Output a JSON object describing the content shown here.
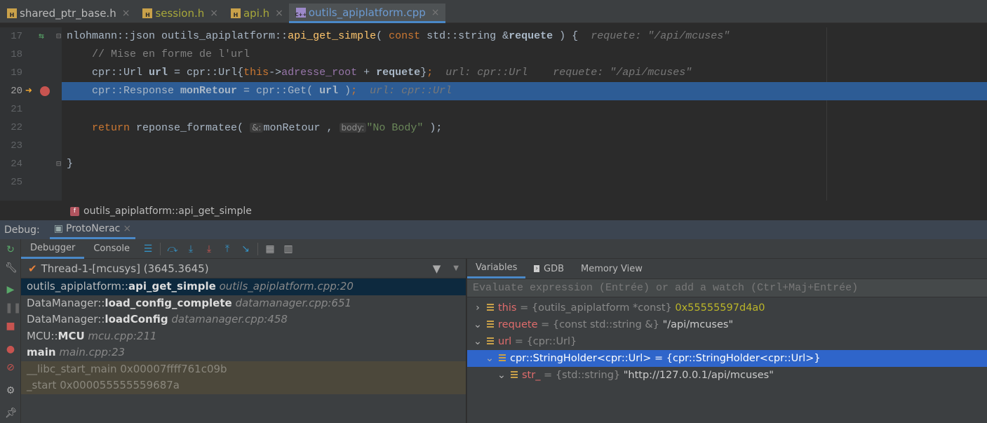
{
  "tabs": [
    {
      "label": "shared_ptr_base.h",
      "type": "H",
      "color": "#bbbbbb"
    },
    {
      "label": "session.h",
      "type": "H",
      "color": "#a8a83a"
    },
    {
      "label": "api.h",
      "type": "H",
      "color": "#a8a83a"
    },
    {
      "label": "outils_apiplatform.cpp",
      "type": "C++",
      "color": "#6c9bd2",
      "active": true
    }
  ],
  "code": [
    {
      "n": "17",
      "tokens": [
        [
          "nlohmann::json outils_apiplatform::",
          "def"
        ],
        [
          "api_get_simple",
          "fn"
        ],
        [
          "( ",
          "def"
        ],
        [
          "const ",
          "kw"
        ],
        [
          "std::string &",
          "def"
        ],
        [
          "requete",
          "bold"
        ],
        [
          " ) {  ",
          "def"
        ],
        [
          "requete: \"/api/mcuses\"",
          "hint"
        ]
      ]
    },
    {
      "n": "18",
      "tokens": [
        [
          "    // Mise en forme de l'url",
          "cm"
        ]
      ]
    },
    {
      "n": "19",
      "tokens": [
        [
          "    cpr::Url ",
          "def"
        ],
        [
          "url",
          "bold"
        ],
        [
          " = cpr::",
          "def"
        ],
        [
          "Url",
          "fn2"
        ],
        [
          "{",
          "def"
        ],
        [
          "this",
          "kw"
        ],
        [
          "->",
          "def"
        ],
        [
          "adresse_root",
          "field"
        ],
        [
          " + ",
          "def"
        ],
        [
          "requete",
          "bold"
        ],
        [
          "}",
          "def"
        ],
        [
          ";",
          "kw"
        ],
        [
          "  url: cpr::Url    requete: \"/api/mcuses\"",
          "hint"
        ]
      ]
    },
    {
      "n": "20",
      "current": true,
      "tokens": [
        [
          "    cpr::Response ",
          "def"
        ],
        [
          "monRetour",
          "bold"
        ],
        [
          " = cpr::",
          "def"
        ],
        [
          "Get",
          "fn2"
        ],
        [
          "( ",
          "def"
        ],
        [
          "url",
          "bold"
        ],
        [
          " )",
          "def"
        ],
        [
          ";",
          "kw"
        ],
        [
          "  url: cpr::Url",
          "hint"
        ]
      ]
    },
    {
      "n": "21",
      "tokens": []
    },
    {
      "n": "22",
      "tokens": [
        [
          "    return ",
          "kw"
        ],
        [
          "reponse_formatee( ",
          "def"
        ],
        [
          "&:",
          "inlay"
        ],
        [
          "monRetour",
          ""
        ],
        [
          " , ",
          "def"
        ],
        [
          "body:",
          "inlay"
        ],
        [
          "\"No Body\"",
          "str"
        ],
        [
          " );",
          "def"
        ]
      ]
    },
    {
      "n": "23",
      "tokens": []
    },
    {
      "n": "24",
      "tokens": [
        [
          "}",
          "def"
        ]
      ]
    },
    {
      "n": "25",
      "tokens": []
    }
  ],
  "breadcrumb": {
    "badge": "f",
    "label": "outils_apiplatform::api_get_simple"
  },
  "debug": {
    "label": "Debug:",
    "config": "ProtoNerac",
    "tab_debugger": "Debugger",
    "tab_console": "Console"
  },
  "thread": "Thread-1-[mcusys] (3645.3645)",
  "frames": [
    {
      "ns": "outils_apiplatform::",
      "fn": "api_get_simple",
      "loc": "outils_apiplatform.cpp:20",
      "sel": true
    },
    {
      "ns": "DataManager::",
      "fn": "load_config_complete",
      "loc": "datamanager.cpp:651"
    },
    {
      "ns": "DataManager::",
      "fn": "loadConfig",
      "loc": "datamanager.cpp:458"
    },
    {
      "ns": "MCU::",
      "fn": "MCU",
      "loc": "mcu.cpp:211"
    },
    {
      "ns": "",
      "fn": "main",
      "loc": "main.cpp:23"
    },
    {
      "lib": true,
      "text": "__libc_start_main 0x00007ffff761c09b"
    },
    {
      "lib": true,
      "text": "_start 0x000055555559687a"
    }
  ],
  "vars_tabs": {
    "variables": "Variables",
    "gdb": "GDB",
    "memory": "Memory View"
  },
  "eval_placeholder": "Evaluate expression (Entrée) or add a watch (Ctrl+Maj+Entrée)",
  "variables": [
    {
      "indent": 0,
      "chev": "›",
      "name": "this",
      "type": "{outils_apiplatform *const}",
      "value": "0x55555597d4a0",
      "num": true
    },
    {
      "indent": 0,
      "chev": "⌄",
      "name": "requete",
      "type": "{const std::string &}",
      "value": "\"/api/mcuses\""
    },
    {
      "indent": 0,
      "chev": "⌄",
      "name": "url",
      "type": "{cpr::Url}",
      "value": ""
    },
    {
      "indent": 1,
      "chev": "⌄",
      "name": "cpr::StringHolder<cpr::Url>",
      "type": "{cpr::StringHolder<cpr::Url>}",
      "value": "",
      "sel": true
    },
    {
      "indent": 2,
      "chev": "⌄",
      "name": "str_",
      "type": "{std::string}",
      "value": "\"http://127.0.0.1/api/mcuses\""
    }
  ]
}
